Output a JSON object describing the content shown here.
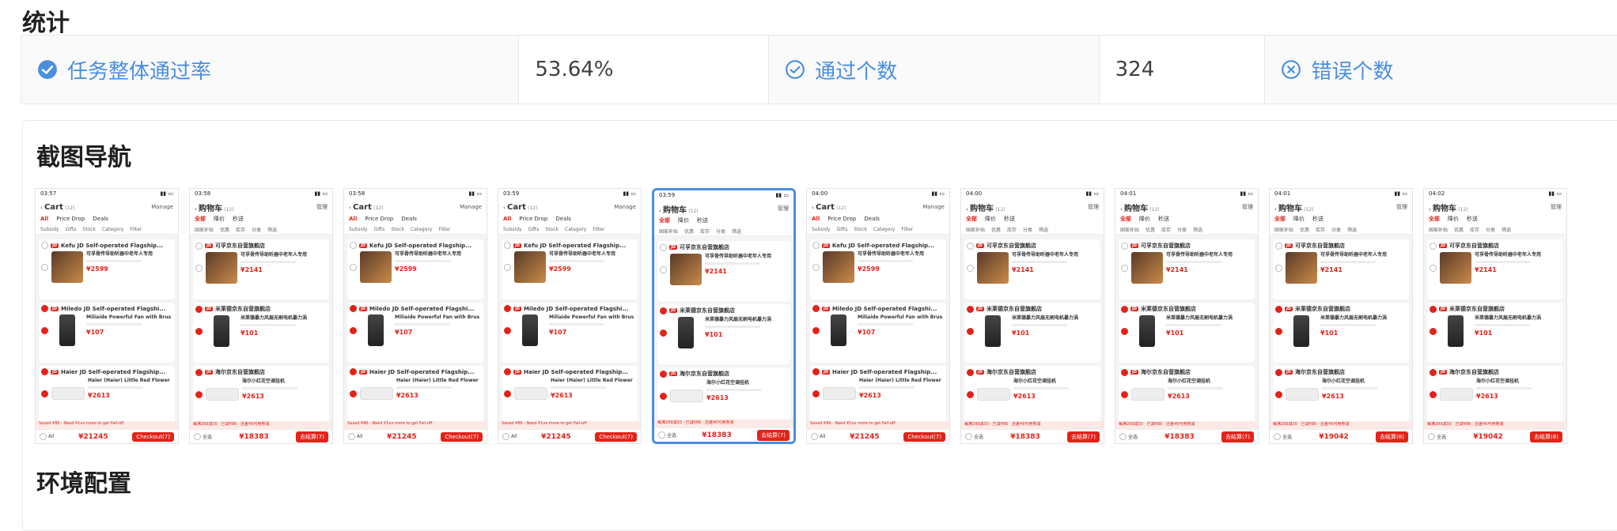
{
  "sections": {
    "stats_title": "统计",
    "nav_title": "截图导航",
    "env_title": "环境配置"
  },
  "stats": {
    "pass_rate_label": "任务整体通过率",
    "pass_rate_value": "53.64%",
    "pass_count_label": "通过个数",
    "pass_count_value": "324",
    "error_count_label": "错误个数"
  },
  "colors": {
    "accent": "#4a8ee0",
    "jd_red": "#e2231a"
  },
  "thumbnails": [
    {
      "time": "03:57",
      "title": "Cart",
      "count": "(12)",
      "manage": "Manage",
      "lang": "en",
      "total": "¥21245",
      "checkout": "Checkout(7)",
      "selected": false
    },
    {
      "time": "03:58",
      "title": "购物车",
      "count": "(12)",
      "manage": "管理",
      "lang": "zh",
      "total": "¥18383",
      "checkout": "去结算(7)",
      "selected": false
    },
    {
      "time": "03:58",
      "title": "Cart",
      "count": "(12)",
      "manage": "Manage",
      "lang": "en",
      "total": "¥21245",
      "checkout": "Checkout(7)",
      "selected": false
    },
    {
      "time": "03:59",
      "title": "Cart",
      "count": "(12)",
      "manage": "Manage",
      "lang": "en",
      "total": "¥21245",
      "checkout": "Checkout(7)",
      "selected": false
    },
    {
      "time": "03:59",
      "title": "购物车",
      "count": "(12)",
      "manage": "管理",
      "lang": "zh",
      "total": "¥18383",
      "checkout": "去结算(7)",
      "selected": true
    },
    {
      "time": "04:00",
      "title": "Cart",
      "count": "(12)",
      "manage": "Manage",
      "lang": "en",
      "total": "¥21245",
      "checkout": "Checkout(7)",
      "selected": false
    },
    {
      "time": "04:00",
      "title": "购物车",
      "count": "(12)",
      "manage": "管理",
      "lang": "zh",
      "total": "¥18383",
      "checkout": "去结算(7)",
      "selected": false
    },
    {
      "time": "04:01",
      "title": "购物车",
      "count": "(12)",
      "manage": "管理",
      "lang": "zh",
      "total": "¥18383",
      "checkout": "去结算(7)",
      "selected": false
    },
    {
      "time": "04:01",
      "title": "购物车",
      "count": "(12)",
      "manage": "管理",
      "lang": "zh",
      "total": "¥19042",
      "checkout": "去结算(8)",
      "selected": false
    },
    {
      "time": "04:02",
      "title": "购物车",
      "count": "(12)",
      "manage": "管理",
      "lang": "zh",
      "total": "¥19042",
      "checkout": "去结算(8)",
      "selected": false
    }
  ],
  "thumb_text": {
    "en": {
      "tabs": [
        "All",
        "Price Drop",
        "Deals"
      ],
      "filters": [
        "Subsidy",
        "Gifts",
        "Stock",
        "Category",
        "Filter"
      ],
      "shops": [
        {
          "name": "Kefu JD Self-operated Flagship...",
          "product": "可孚骨传导助听器中老年人专用",
          "price": "¥2599",
          "img": "ph"
        },
        {
          "name": "Miledo JD Self-operated Flagshi...",
          "product": "Miliaide Powerful Fan with Brus",
          "price": "¥107",
          "img": "fan"
        },
        {
          "name": "Haier JD Self-operated Flagship...",
          "product": "Haier (Haier) Little Red Flower",
          "price": "¥2613",
          "img": "ac"
        }
      ],
      "notice": "Saved ¥86 · Need ¥1xx more to get Fall-off",
      "all": "All"
    },
    "zh": {
      "tabs": [
        "全部",
        "降价",
        "秒送"
      ],
      "filters": [
        "国家补贴",
        "优惠",
        "库存",
        "分类",
        "筛选"
      ],
      "shops": [
        {
          "name": "可孚京东自营旗舰店",
          "product": "可孚骨传导助听器中老年人专用",
          "price": "¥2141",
          "img": "ph"
        },
        {
          "name": "米莱德京东自营旗舰店",
          "product": "米莱德暴力风扇无刷电机暴力涡",
          "price": "¥101",
          "img": "fan"
        },
        {
          "name": "海尔京东自营旗舰店",
          "product": "海尔小红花空调挂机",
          "price": "¥2613",
          "img": "ac"
        }
      ],
      "notice": "每满299减30 · 已减¥86 · 还差¥6可用券减",
      "all": "全选"
    }
  }
}
